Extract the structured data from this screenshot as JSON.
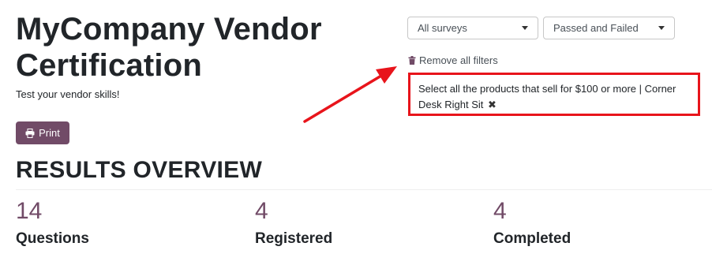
{
  "survey": {
    "title": "MyCompany Vendor Certification",
    "subtitle": "Test your vendor skills!"
  },
  "actions": {
    "print_label": "Print"
  },
  "filters": {
    "survey_select": "All surveys",
    "status_select": "Passed and Failed",
    "remove_all_label": "Remove all filters",
    "active_filter": "Select all the products that sell for $100 or more | Corner Desk Right Sit",
    "remove_filter_glyph": "✖"
  },
  "results": {
    "heading": "RESULTS OVERVIEW",
    "stats": [
      {
        "value": "14",
        "label": "Questions"
      },
      {
        "value": "4",
        "label": "Registered"
      },
      {
        "value": "4",
        "label": "Completed"
      }
    ]
  },
  "colors": {
    "accent": "#714b67",
    "highlight": "#e8141b"
  },
  "icons": {
    "print": "printer-icon",
    "remove_filters": "trash-icon",
    "filter_remove": "close-icon",
    "dropdown": "caret-down-icon"
  }
}
